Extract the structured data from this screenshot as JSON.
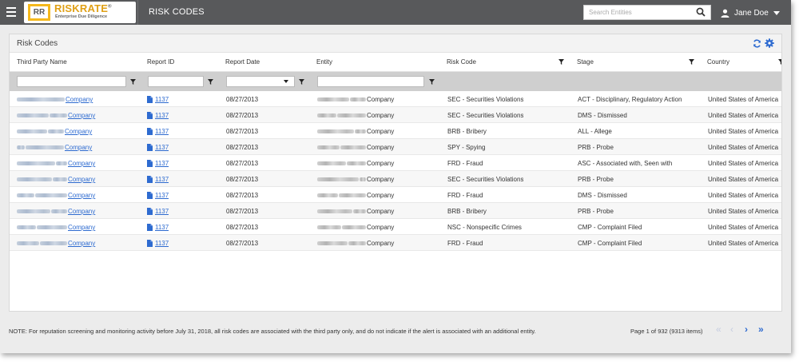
{
  "topbar": {
    "logo_mark": "RR",
    "logo_name": "RISKRATE",
    "logo_reg": "®",
    "logo_tagline": "Enterprise Due Diligence",
    "page_title": "RISK CODES",
    "search_placeholder": "Search Entities",
    "user_name": "Jane Doe"
  },
  "panel": {
    "title": "Risk Codes",
    "columns": [
      "Third Party Name",
      "Report ID",
      "Report Date",
      "Entity",
      "Risk Code",
      "Stage",
      "Country"
    ],
    "rows": [
      {
        "third_party": "Company",
        "report_id": "1137",
        "report_date": "08/27/2013",
        "entity": "Company",
        "risk_code": "SEC - Securities Violations",
        "stage": "ACT - Disciplinary, Regulatory Action",
        "country": "United States of America"
      },
      {
        "third_party": "Company",
        "report_id": "1137",
        "report_date": "08/27/2013",
        "entity": "Company",
        "risk_code": "SEC - Securities Violations",
        "stage": "DMS - Dismissed",
        "country": "United States of America"
      },
      {
        "third_party": "Company",
        "report_id": "1137",
        "report_date": "08/27/2013",
        "entity": "Company",
        "risk_code": "BRB - Bribery",
        "stage": "ALL - Allege",
        "country": "United States of America"
      },
      {
        "third_party": "Company",
        "report_id": "1137",
        "report_date": "08/27/2013",
        "entity": "Company",
        "risk_code": "SPY - Spying",
        "stage": "PRB - Probe",
        "country": "United States of America"
      },
      {
        "third_party": "Company",
        "report_id": "1137",
        "report_date": "08/27/2013",
        "entity": "Company",
        "risk_code": "FRD - Fraud",
        "stage": "ASC - Associated with, Seen with",
        "country": "United States of America"
      },
      {
        "third_party": "Company",
        "report_id": "1137",
        "report_date": "08/27/2013",
        "entity": "Company",
        "risk_code": "SEC - Securities Violations",
        "stage": "PRB - Probe",
        "country": "United States of America"
      },
      {
        "third_party": "Company",
        "report_id": "1137",
        "report_date": "08/27/2013",
        "entity": "Company",
        "risk_code": "FRD - Fraud",
        "stage": "DMS - Dismissed",
        "country": "United States of America"
      },
      {
        "third_party": "Company",
        "report_id": "1137",
        "report_date": "08/27/2013",
        "entity": "Company",
        "risk_code": "BRB - Bribery",
        "stage": "PRB - Probe",
        "country": "United States of America"
      },
      {
        "third_party": "Company",
        "report_id": "1137",
        "report_date": "08/27/2013",
        "entity": "Company",
        "risk_code": "NSC - Nonspecific Crimes",
        "stage": "CMP - Complaint Filed",
        "country": "United States of America"
      },
      {
        "third_party": "Company",
        "report_id": "1137",
        "report_date": "08/27/2013",
        "entity": "Company",
        "risk_code": "FRD - Fraud",
        "stage": "CMP - Complaint Filed",
        "country": "United States of America"
      }
    ]
  },
  "footer": {
    "note": "NOTE: For reputation screening and monitoring activity before July 31, 2018, all risk codes are associated with the third party only, and do not indicate if the alert is associated with an additional entity.",
    "page_info": "Page 1 of 932 (9313 items)",
    "first": "«",
    "prev": "‹",
    "next": "›",
    "last": "»"
  },
  "colors": {
    "topbar": "#58595b",
    "logo_accent": "#f5b81c",
    "link": "#2e6bd0",
    "icon_blue": "#2e6bd0"
  }
}
